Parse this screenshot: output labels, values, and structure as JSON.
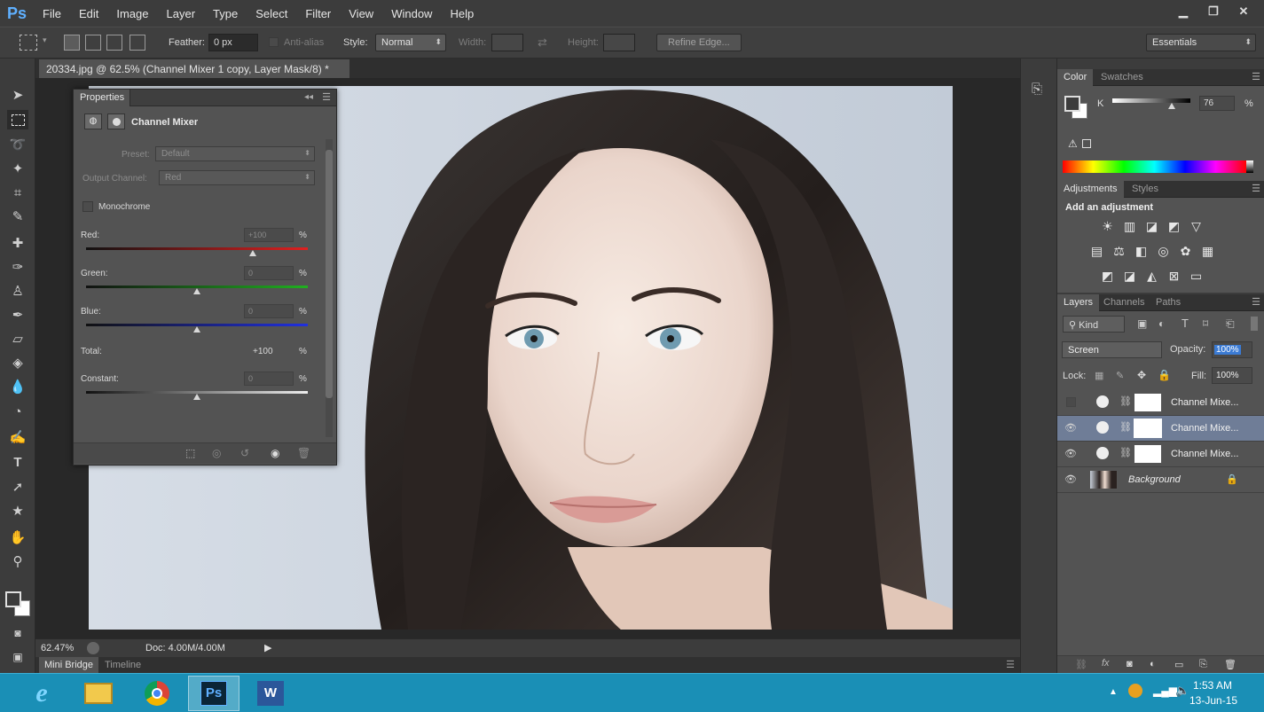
{
  "app": {
    "logo": "Ps",
    "menu": [
      "File",
      "Edit",
      "Image",
      "Layer",
      "Type",
      "Select",
      "Filter",
      "View",
      "Window",
      "Help"
    ],
    "window_controls": [
      "minimize-icon",
      "restore-icon",
      "close-icon"
    ]
  },
  "options": {
    "feather_label": "Feather:",
    "feather_value": "0 px",
    "antialias_label": "Anti-alias",
    "style_label": "Style:",
    "style_value": "Normal",
    "width_label": "Width:",
    "height_label": "Height:",
    "refine_edge": "Refine Edge...",
    "workspace": "Essentials"
  },
  "document": {
    "tab_title": "20334.jpg @ 62.5% (Channel Mixer 1 copy, Layer Mask/8) *",
    "close_glyph": "×",
    "zoom": "62.47%",
    "doc_size": "Doc: 4.00M/4.00M",
    "bottom_tabs": [
      "Mini Bridge",
      "Timeline"
    ]
  },
  "properties": {
    "tab": "Properties",
    "title": "Channel Mixer",
    "preset_label": "Preset:",
    "preset_value": "Default",
    "output_label": "Output Channel:",
    "output_value": "Red",
    "monochrome_label": "Monochrome",
    "monochrome_checked": false,
    "red_label": "Red:",
    "red_value": "+100",
    "green_label": "Green:",
    "green_value": "0",
    "blue_label": "Blue:",
    "blue_value": "0",
    "total_label": "Total:",
    "total_value": "+100",
    "constant_label": "Constant:",
    "constant_value": "0",
    "percent": "%",
    "red_level": 100,
    "green_level": 0,
    "blue_level": 0,
    "constant_level": 0
  },
  "color_panel": {
    "tabs": [
      "Color",
      "Swatches"
    ],
    "channel_label": "K",
    "channel_value": "76",
    "percent": "%",
    "level": 76
  },
  "adjustments": {
    "tabs": [
      "Adjustments",
      "Styles"
    ],
    "heading": "Add an adjustment",
    "row1": [
      "brightness-icon",
      "levels-icon",
      "curves-icon",
      "exposure-icon",
      "vibrance-icon"
    ],
    "row2": [
      "hue-saturation-icon",
      "color-balance-icon",
      "black-white-icon",
      "photo-filter-icon",
      "channel-mixer-icon",
      "color-lookup-icon"
    ],
    "row3": [
      "invert-icon",
      "posterize-icon",
      "threshold-icon",
      "selective-color-icon",
      "gradient-map-icon"
    ]
  },
  "layers_panel": {
    "tabs": [
      "Layers",
      "Channels",
      "Paths"
    ],
    "kind_label": "Kind",
    "blend_mode": "Screen",
    "opacity_label": "Opacity:",
    "opacity_value": "100%",
    "lock_label": "Lock:",
    "fill_label": "Fill:",
    "fill_value": "100%",
    "layers": [
      {
        "name": "Channel Mixe...",
        "visible": false,
        "selected": false
      },
      {
        "name": "Channel Mixe...",
        "visible": true,
        "selected": true
      },
      {
        "name": "Channel Mixe...",
        "visible": true,
        "selected": false
      },
      {
        "name": "Background",
        "visible": true,
        "selected": false
      }
    ]
  },
  "taskbar": {
    "time": "1:53 AM",
    "date": "13-Jun-15",
    "apps": [
      "ie-icon",
      "explorer-icon",
      "chrome-icon",
      "photoshop-icon",
      "word-icon"
    ],
    "ps_label": "Ps",
    "word_label": "W"
  },
  "colors": {
    "accent": "#1a8fb6",
    "selected_layer": "#6f7d97",
    "panel": "#535353",
    "dark": "#3c3c3c"
  }
}
